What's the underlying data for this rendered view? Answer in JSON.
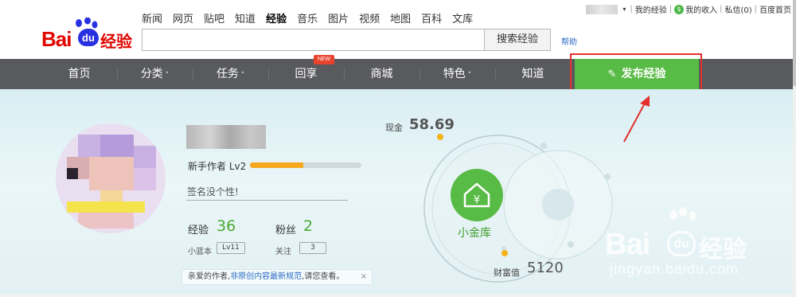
{
  "header": {
    "logo": {
      "bai": "Bai",
      "du": "du",
      "jingyan": "经验"
    },
    "nav_links": [
      "新闻",
      "网页",
      "贴吧",
      "知道",
      "经验",
      "音乐",
      "图片",
      "视频",
      "地图",
      "百科",
      "文库"
    ],
    "active_nav": "经验",
    "search": {
      "value": "",
      "button": "搜索经验"
    },
    "help": "帮助",
    "top_right": {
      "my_experience": "我的经验",
      "my_income": "我的收入",
      "messages": "私信(0)",
      "baidu_home": "百度首页"
    }
  },
  "menu": {
    "items": [
      "首页",
      "分类",
      "任务",
      "回享",
      "商城",
      "特色",
      "知道"
    ],
    "dropdown_items": [
      "分类",
      "任务",
      "特色"
    ],
    "new_badge": "NEW",
    "publish_button": "发布经验"
  },
  "profile": {
    "level_text": "新手作者 Lv2",
    "level_progress": 0.48,
    "signature": "签名没个性!",
    "experience_label": "经验",
    "experience_value": "36",
    "fans_label": "粉丝",
    "fans_value": "2",
    "blue_book_label": "小蓝本",
    "blue_book_value": "Lv11",
    "follow_label": "关注",
    "follow_value": "3"
  },
  "notice": {
    "prefix": "亲爱的作者,",
    "link": "非原创内容最新规范",
    "suffix": ",请您查看。",
    "close": "×"
  },
  "vault": {
    "cash_label": "现金",
    "cash_value": "58.69",
    "vault_label": "小金库",
    "wealth_label": "财富值",
    "wealth_value": "5120"
  },
  "watermark": {
    "bai": "Bai",
    "du": "du",
    "jingyan": "经验",
    "url": "jingyan.baidu.com"
  },
  "colors": {
    "brand_red": "#e10601",
    "brand_blue": "#2932e1",
    "green": "#58bb45",
    "menubar": "#595a5e",
    "highlight_red": "#e4302c",
    "progress": "#f5a81d"
  }
}
